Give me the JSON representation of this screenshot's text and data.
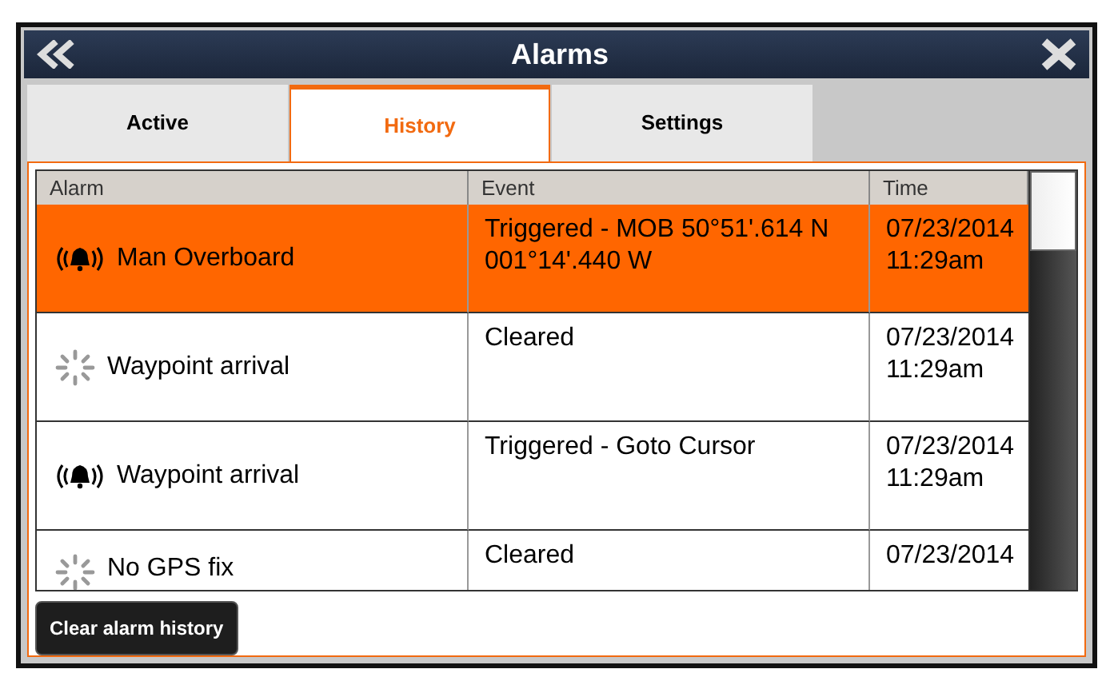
{
  "window": {
    "title": "Alarms"
  },
  "tabs": [
    {
      "label": "Active",
      "selected": false
    },
    {
      "label": "History",
      "selected": true
    },
    {
      "label": "Settings",
      "selected": false
    }
  ],
  "table": {
    "columns": [
      "Alarm",
      "Event",
      "Time"
    ],
    "rows": [
      {
        "kind": "triggered",
        "selected": true,
        "alarm": "Man Overboard",
        "event": "Triggered - MOB 50°51'.614 N 001°14'.440 W",
        "time": [
          "07/23/2014",
          "11:29am"
        ]
      },
      {
        "kind": "cleared",
        "selected": false,
        "alarm": "Waypoint arrival",
        "event": "Cleared",
        "time": [
          "07/23/2014",
          "11:29am"
        ]
      },
      {
        "kind": "triggered",
        "selected": false,
        "alarm": "Waypoint arrival",
        "event": "Triggered - Goto Cursor",
        "time": [
          "07/23/2014",
          "11:29am"
        ]
      },
      {
        "kind": "cleared",
        "selected": false,
        "alarm": "No GPS fix",
        "event": "Cleared",
        "time": [
          "07/23/2014"
        ]
      }
    ]
  },
  "buttons": [
    "Clear alarm history"
  ]
}
